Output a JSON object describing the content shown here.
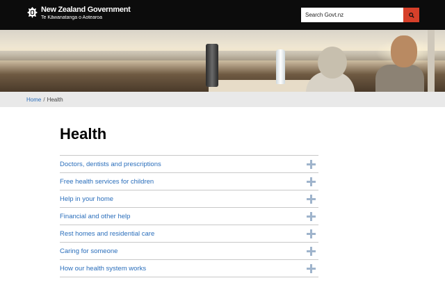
{
  "header": {
    "logo_main": "New Zealand Government",
    "logo_sub": "Te Kāwanatanga o Aotearoa",
    "search_placeholder": "Search Govt.nz",
    "search_icon": "magnifier-icon",
    "accent_color": "#d6402a"
  },
  "breadcrumb": {
    "home": "Home",
    "separator": "/",
    "current": "Health"
  },
  "main": {
    "title": "Health",
    "items": [
      {
        "label": "Doctors, dentists and prescriptions"
      },
      {
        "label": "Free health services for children"
      },
      {
        "label": "Help in your home"
      },
      {
        "label": "Financial and other help"
      },
      {
        "label": "Rest homes and residential care"
      },
      {
        "label": "Caring for someone"
      },
      {
        "label": "How our health system works"
      }
    ]
  }
}
